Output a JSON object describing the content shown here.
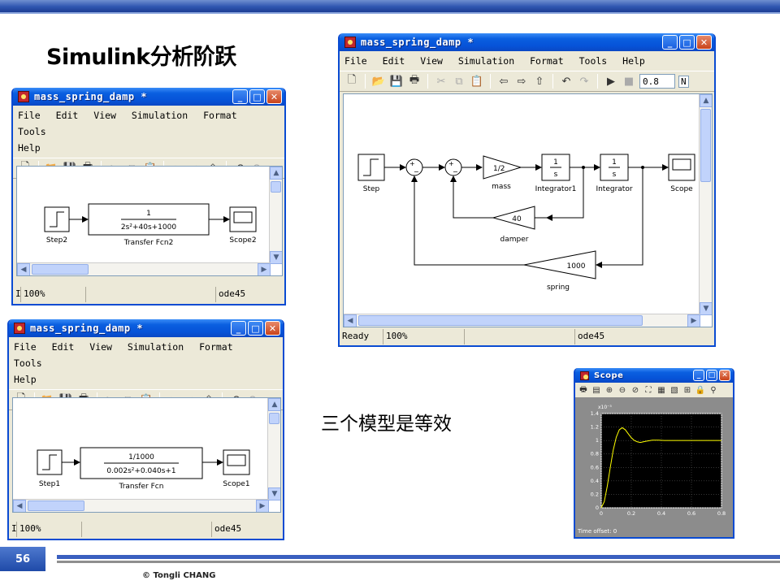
{
  "slide": {
    "title": "Simulink分析阶跃",
    "equivalence_note": "三个模型是等效",
    "page_number": "56",
    "copyright": "© Tongli  CHANG"
  },
  "menu_items": [
    "File",
    "Edit",
    "View",
    "Simulation",
    "Format",
    "Tools",
    "Help"
  ],
  "windows": {
    "top_left": {
      "title": "mass_spring_damp *",
      "status": {
        "left": "I",
        "zoom": "100%",
        "solver": "ode45"
      },
      "blocks": {
        "step": "Step2",
        "tf_num": "1",
        "tf_den": "2s²+40s+1000",
        "tf_name": "Transfer Fcn2",
        "scope": "Scope2"
      }
    },
    "bottom_left": {
      "title": "mass_spring_damp *",
      "status": {
        "left": "I",
        "zoom": "100%",
        "solver": "ode45"
      },
      "blocks": {
        "step": "Step1",
        "tf_num": "1/1000",
        "tf_den": "0.002s²+0.040s+1",
        "tf_name": "Transfer Fcn",
        "scope": "Scope1"
      }
    },
    "right": {
      "title": "mass_spring_damp *",
      "stop_time": "0.8",
      "stop_time_suffix": "N",
      "status": {
        "left": "Ready",
        "zoom": "100%",
        "solver": "ode45"
      },
      "blocks": {
        "step": "Step",
        "mass_gain": "1/2",
        "mass_label": "mass",
        "int1_num": "1",
        "int1_den": "s",
        "int1_label": "Integrator1",
        "int2_num": "1",
        "int2_den": "s",
        "int2_label": "Integrator",
        "scope": "Scope",
        "damper_gain": "40",
        "damper_label": "damper",
        "spring_gain": "1000",
        "spring_label": "spring",
        "sum_minus": "−"
      }
    }
  },
  "scope": {
    "title": "Scope",
    "time_offset_label": "Time offset:",
    "time_offset_value": "0"
  },
  "chart_data": {
    "type": "line",
    "title": "",
    "xlabel": "",
    "ylabel": "",
    "y_exponent": "x10⁻³",
    "xlim": [
      0,
      0.8
    ],
    "ylim": [
      0,
      1.4
    ],
    "xticks": [
      "0",
      "0.2",
      "0.4",
      "0.6",
      "0.8"
    ],
    "yticks": [
      "0",
      "0.2",
      "0.4",
      "0.6",
      "0.8",
      "1",
      "1.2",
      "1.4"
    ],
    "grid": true,
    "series": [
      {
        "color": "#ffff00",
        "x": [
          0,
          0.02,
          0.04,
          0.06,
          0.08,
          0.1,
          0.12,
          0.14,
          0.16,
          0.18,
          0.2,
          0.22,
          0.24,
          0.26,
          0.28,
          0.3,
          0.34,
          0.38,
          0.42,
          0.5,
          0.6,
          0.7,
          0.8
        ],
        "y": [
          0,
          0.09,
          0.32,
          0.6,
          0.86,
          1.05,
          1.16,
          1.19,
          1.16,
          1.1,
          1.04,
          1.0,
          0.98,
          0.97,
          0.98,
          0.99,
          1.005,
          1.005,
          1.0,
          1.0,
          1.0,
          1.0,
          1.0
        ]
      }
    ]
  }
}
